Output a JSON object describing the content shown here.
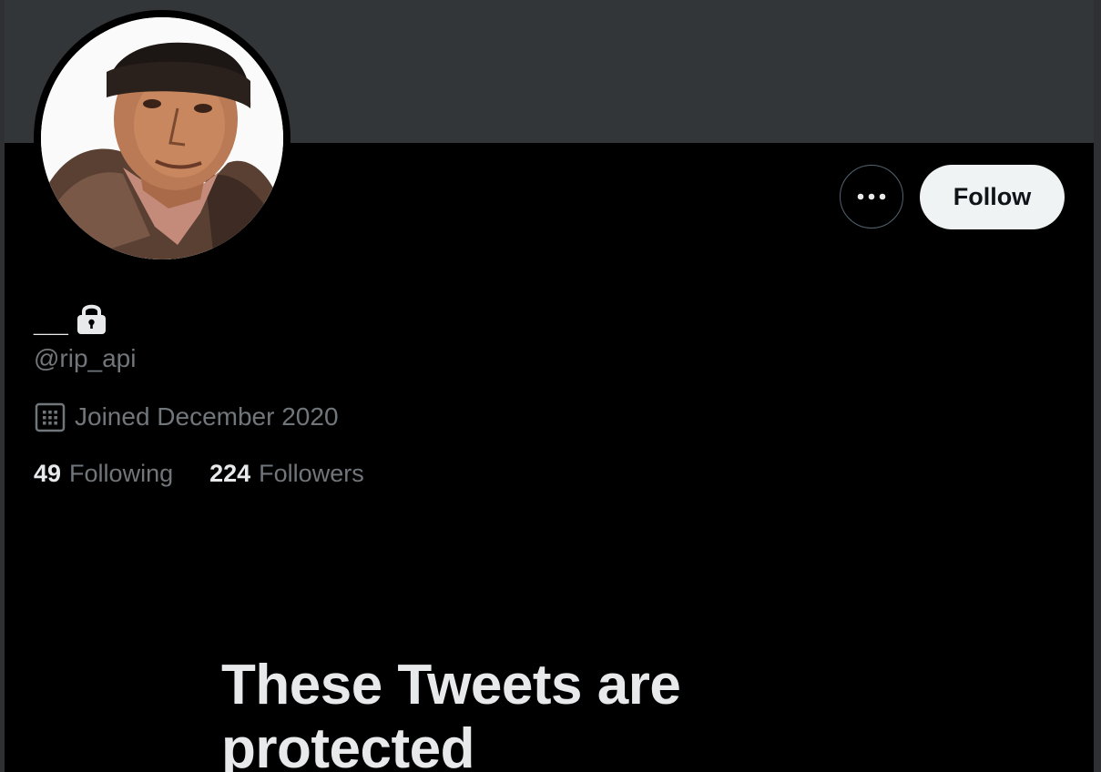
{
  "profile": {
    "display_name": "__",
    "handle": "@rip_api",
    "joined": "Joined December 2020",
    "following_count": "49",
    "following_label": "Following",
    "followers_count": "224",
    "followers_label": "Followers",
    "protected": true
  },
  "actions": {
    "more_icon": "ellipsis-icon",
    "follow_label": "Follow"
  },
  "icons": {
    "lock": "lock-icon",
    "calendar": "calendar-icon"
  },
  "protected_notice": {
    "title": "These Tweets are protected"
  },
  "colors": {
    "background": "#000000",
    "banner": "#333639",
    "primary_text": "#e7e9ea",
    "secondary_text": "#71767b",
    "follow_button_bg": "#eff3f4",
    "follow_button_text": "#0f1419",
    "outline": "#536471"
  }
}
